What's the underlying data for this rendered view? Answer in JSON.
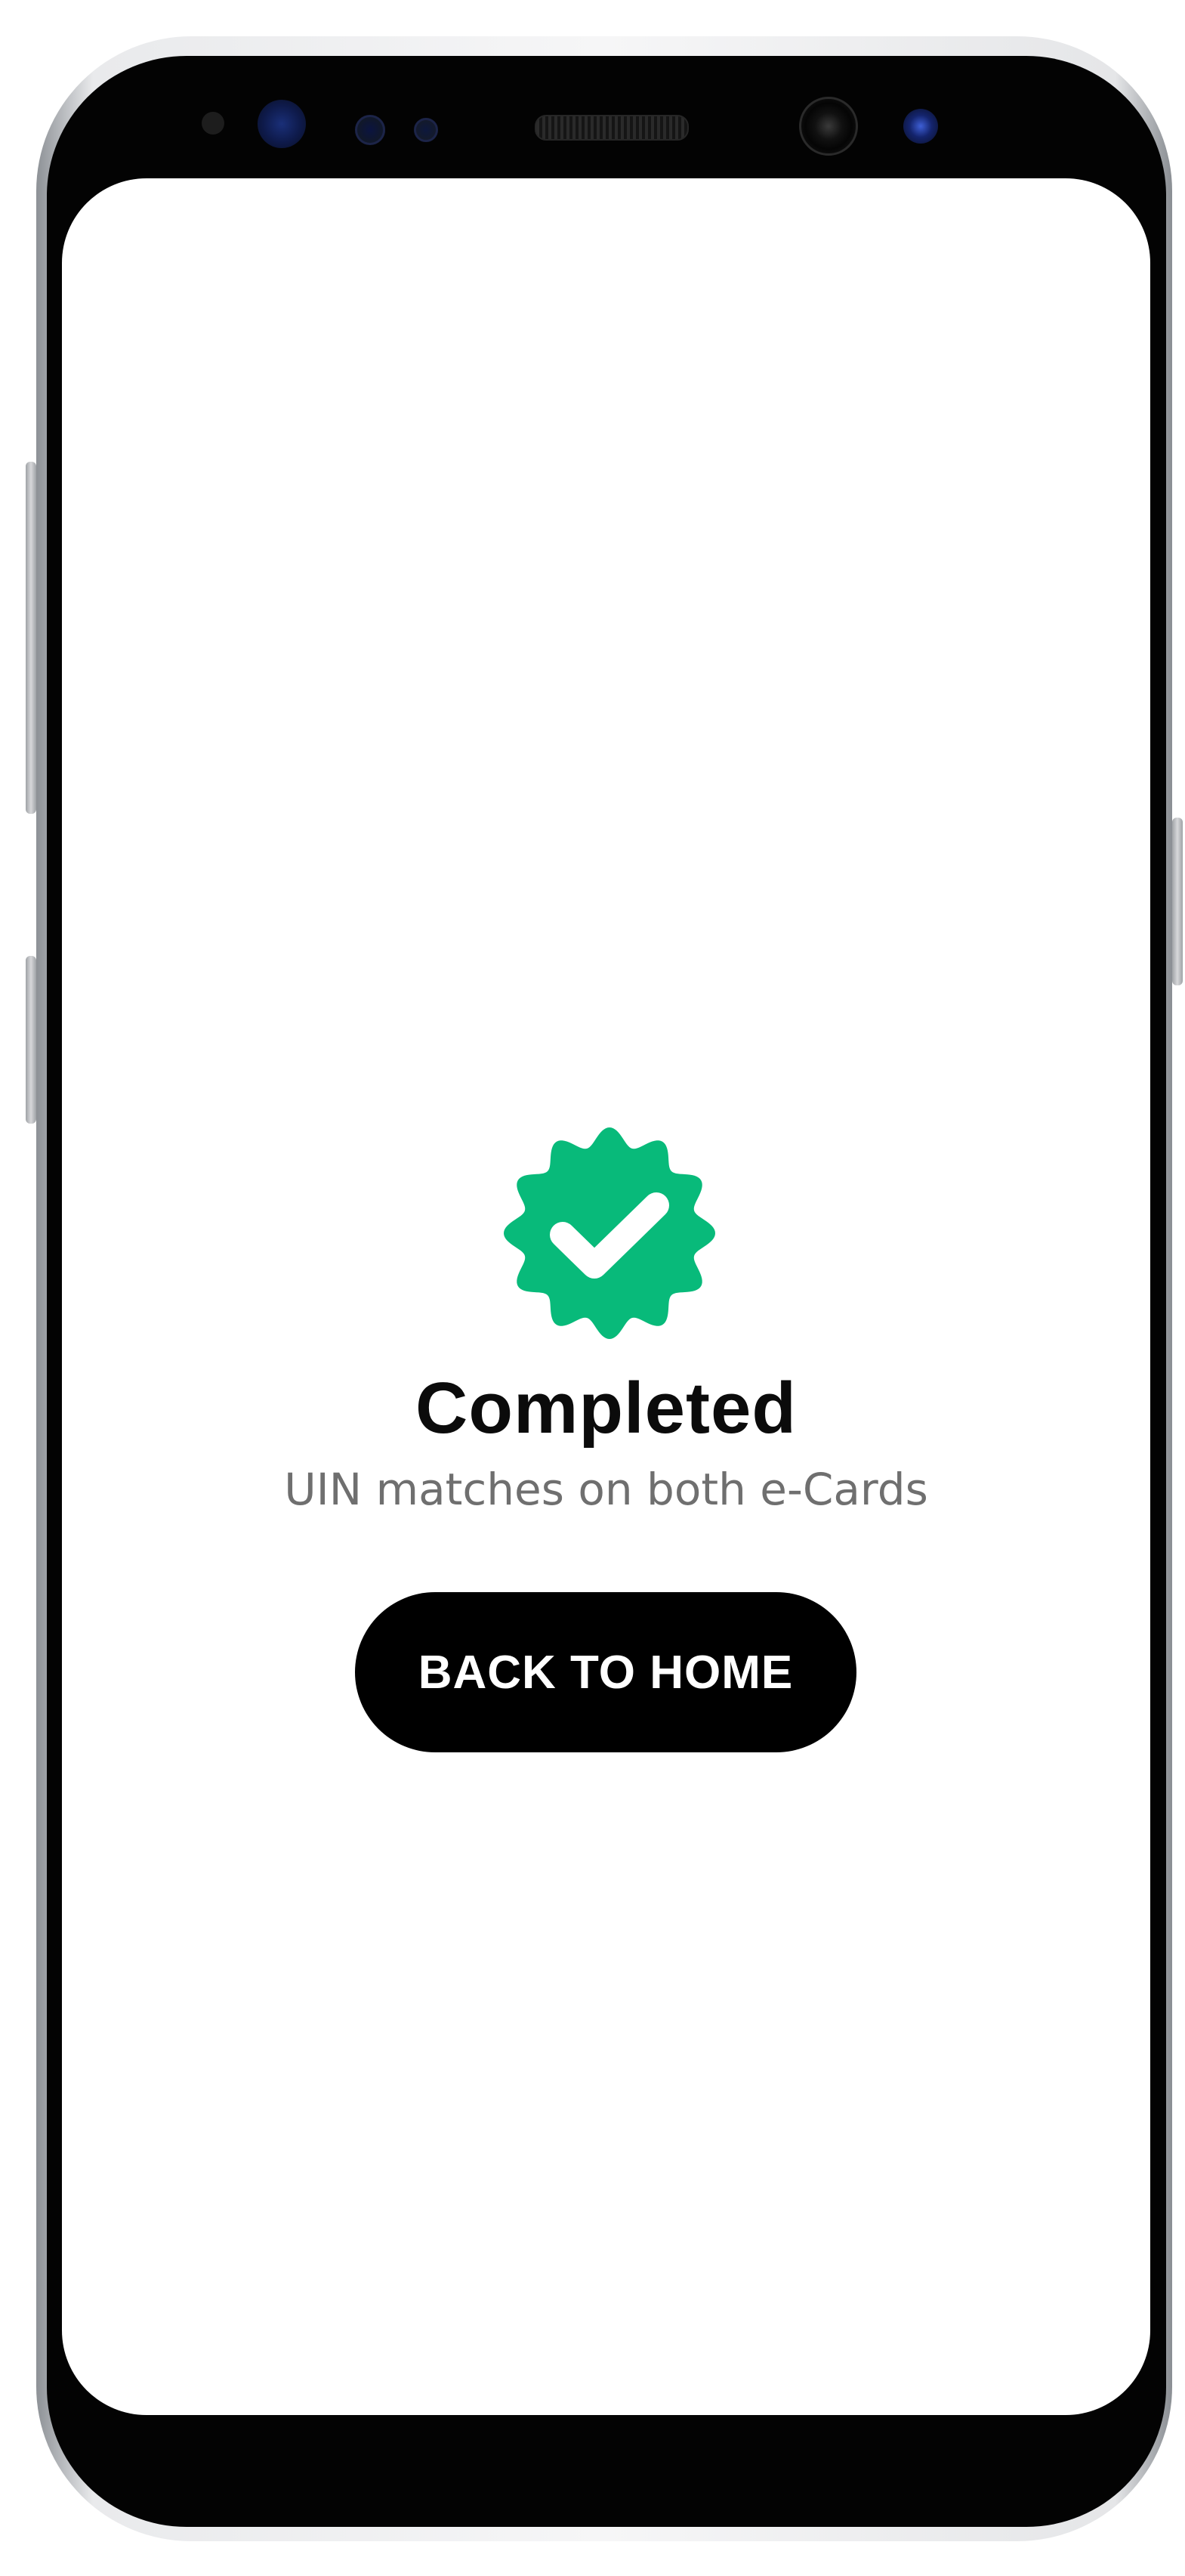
{
  "status": {
    "title": "Completed",
    "message": "UIN matches on both e-Cards",
    "icon": "verified-check-icon",
    "icon_color": "#08BA7A"
  },
  "actions": {
    "back_home_label": "BACK TO HOME",
    "button_color": "#000000",
    "button_text_color": "#FFFFFF"
  }
}
